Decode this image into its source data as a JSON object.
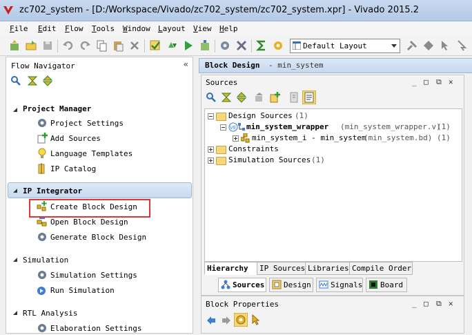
{
  "window": {
    "title": "zc702_system - [D:/Workspace/Vivado/zc702_system/zc702_system.xpr] - Vivado 2015.2"
  },
  "menu": [
    {
      "label": "File",
      "u": "F",
      "rest": "ile"
    },
    {
      "label": "Edit",
      "u": "E",
      "rest": "dit"
    },
    {
      "label": "Flow",
      "u": "F",
      "rest": "low"
    },
    {
      "label": "Tools",
      "u": "T",
      "rest": "ools"
    },
    {
      "label": "Window",
      "u": "W",
      "rest": "indow"
    },
    {
      "label": "Layout",
      "u": "L",
      "rest": "ayout"
    },
    {
      "label": "View",
      "u": "V",
      "rest": "iew"
    },
    {
      "label": "Help",
      "u": "H",
      "rest": "elp"
    }
  ],
  "toolbar": {
    "layout_value": "Default Layout"
  },
  "flow_navigator": {
    "title": "Flow Navigator",
    "collapse": "«",
    "sections": {
      "project_manager": {
        "label": "Project Manager",
        "items": [
          "Project Settings",
          "Add Sources",
          "Language Templates",
          "IP Catalog"
        ]
      },
      "ip_integrator": {
        "label": "IP Integrator",
        "items": [
          "Create Block Design",
          "Open Block Design",
          "Generate Block Design"
        ]
      },
      "simulation": {
        "label": "Simulation",
        "items": [
          "Simulation Settings",
          "Run Simulation"
        ]
      },
      "rtl_analysis": {
        "label": "RTL Analysis",
        "items": [
          "Elaboration Settings"
        ]
      }
    }
  },
  "block_design_bar": {
    "title": "Block Design",
    "subtitle": "- min_system"
  },
  "sources": {
    "title": "Sources",
    "tree": {
      "design_sources": {
        "label": "Design Sources",
        "count": "(1)"
      },
      "wrapper": {
        "label": "min_system_wrapper",
        "file": "(min_system_wrapper.v)",
        "count": "(1)"
      },
      "instance": {
        "label": "min_system_i - min_system",
        "file": "(min_system.bd)",
        "count": "(1)"
      },
      "constraints": {
        "label": "Constraints"
      },
      "sim_sources": {
        "label": "Simulation Sources",
        "count": "(1)"
      }
    },
    "view_tabs": [
      "Hierarchy",
      "IP Sources",
      "Libraries",
      "Compile Order"
    ],
    "bottom_tabs": [
      "Sources",
      "Design",
      "Signals",
      "Board"
    ]
  },
  "block_properties": {
    "title": "Block Properties"
  },
  "colors": {
    "highlight_box": "#e03535",
    "header_blue": "#c6d8ee"
  }
}
